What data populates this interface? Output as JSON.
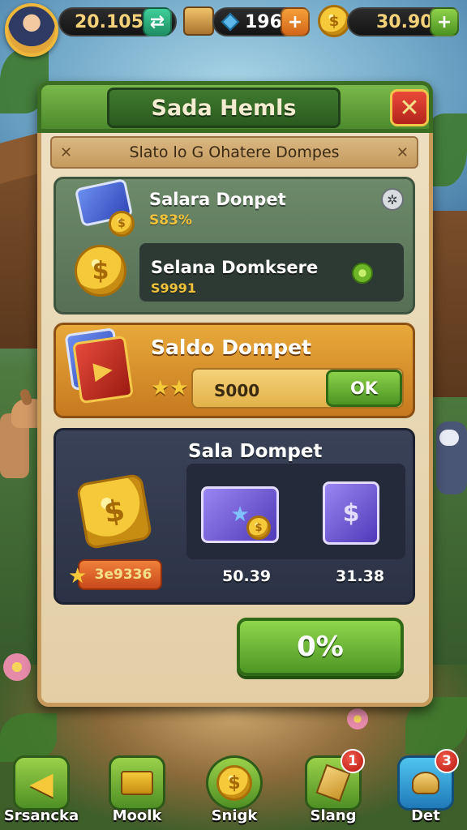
{
  "top_bar": {
    "resource_1": "20.105",
    "resource_1_button": "⇄",
    "resource_2": "196",
    "resource_2_button": "+",
    "resource_3": "30.90",
    "resource_3_button": "+"
  },
  "panel": {
    "title": "Sada Hemls",
    "close_label": "✕",
    "subtitle": "Slato lo G Ohatere Dompes"
  },
  "section_1": {
    "item_1_title": "Salara Donpet",
    "item_1_value": "S83%",
    "item_2_title": "Selana Domksere",
    "item_2_value": "S9991"
  },
  "section_2": {
    "title": "Saldo Dompet",
    "input_value": "S000",
    "ok_label": "OK"
  },
  "section_3": {
    "title": "Sala Dompet",
    "tag_value": "3e9336",
    "card_1_value": "50.39",
    "card_2_value": "31.38"
  },
  "confirm_button": "0%",
  "bottom_nav": [
    {
      "label": "Srsancka",
      "badge": ""
    },
    {
      "label": "Moolk",
      "badge": ""
    },
    {
      "label": "Snigk",
      "badge": ""
    },
    {
      "label": "Slang",
      "badge": "1"
    },
    {
      "label": "Det",
      "badge": "3"
    }
  ],
  "colors": {
    "panel_bg": "#ede0c2",
    "header_green": "#4d8a2c",
    "gold": "#f1c23c",
    "ok_green": "#4e9724",
    "close_red": "#b3241b"
  }
}
